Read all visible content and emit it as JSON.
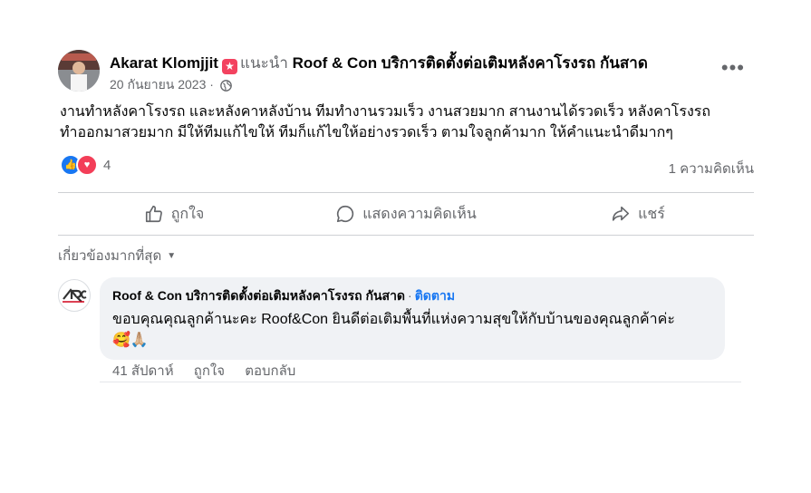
{
  "post": {
    "author": "Akarat Klomjjit",
    "recommend_word": "แนะนำ",
    "page_name": "Roof & Con บริการติดตั้งต่อเติมหลังคาโรงรถ กันสาด",
    "date": "20 กันยายน 2023",
    "date_sep": "·",
    "more_label": "•••",
    "body_lines": [
      "งานทำหลังคาโรงรถ และหลังคาหลังบ้าน ทีมทำงานรวมเร็ว งานสวยมาก สานงานได้รวดเร็ว หลังคาโรงรถ",
      "ทำออกมาสวยมาก มีให้ทีมแก้ไขให้ ทีมก็แก้ไขให้อย่างรวดเร็ว ตามใจลูกค้ามาก ให้คำแนะนำดีมากๆ"
    ]
  },
  "stats": {
    "reaction_count": "4",
    "comment_count": "1 ความคิดเห็น"
  },
  "actions": {
    "like": "ถูกใจ",
    "comment": "แสดงความคิดเห็น",
    "share": "แชร์"
  },
  "filter": {
    "label": "เกี่ยวข้องมากที่สุด"
  },
  "comment": {
    "author": "Roof & Con บริการติดตั้งต่อเติมหลังคาโรงรถ กันสาด",
    "dot": "·",
    "follow": "ติดตาม",
    "text": "ขอบคุณคุณลูกค้านะคะ Roof&Con ยินดีต่อเติมพื้นที่แห่งความสุขให้กับบ้านของคุณลูกค้าค่ะ",
    "emoji": "🥰🙏🏼",
    "time": "41 สัปดาห์",
    "like": "ถูกใจ",
    "reply": "ตอบกลับ"
  },
  "colors": {
    "link": "#1877f2",
    "secondary_text": "#65676b",
    "bubble": "#f0f2f5",
    "recommend_badge": "#f3425f"
  }
}
